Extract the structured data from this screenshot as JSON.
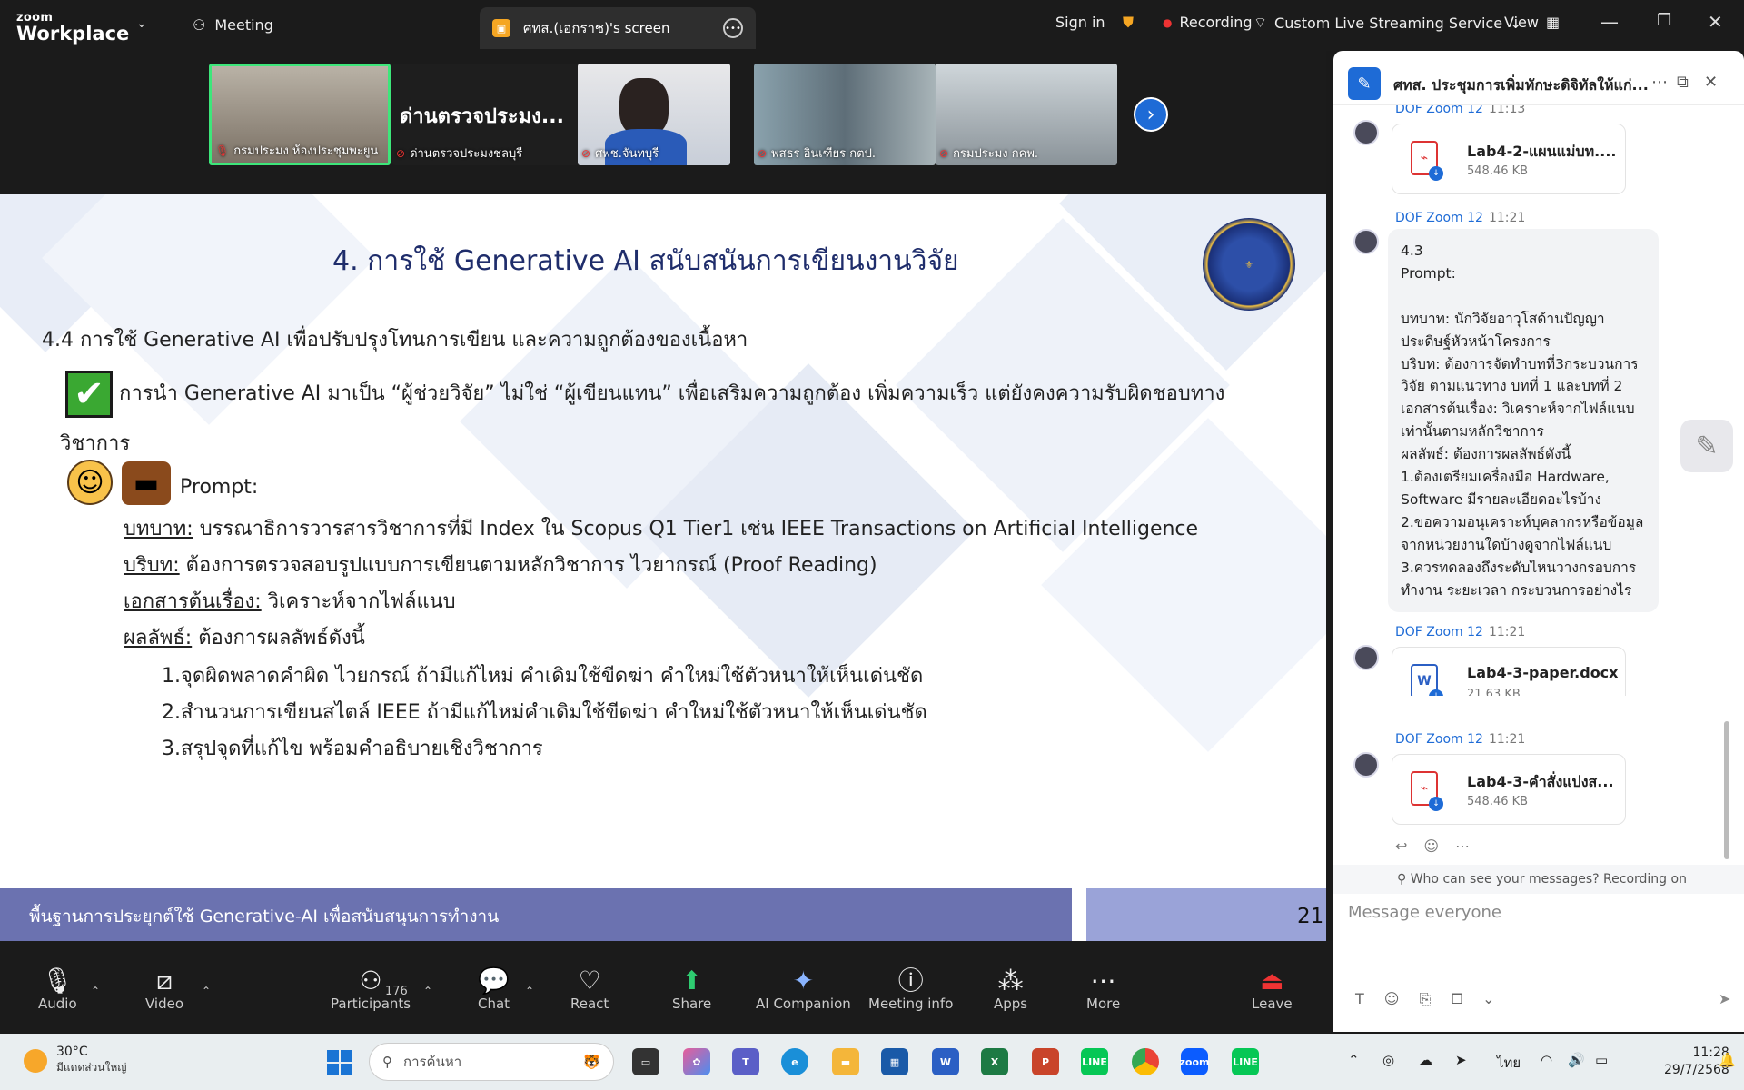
{
  "topbar": {
    "logo_line1": "zoom",
    "logo_line2": "Workplace",
    "meeting_label": "Meeting",
    "screen_tab": "ศทส.(เอกราช)'s screen",
    "sign_in": "Sign in",
    "recording": "Recording",
    "streaming": "Custom Live Streaming Service",
    "view": "View"
  },
  "participants_strip": [
    {
      "label": "กรมประมง ห้องประชุมพะยูน",
      "active": true
    },
    {
      "label": "ด่านตรวจประมงชลบุรี",
      "heading": "ด่านตรวจประมง...",
      "active": false
    },
    {
      "label": "ศพช.จันทบุรี",
      "active": false
    },
    {
      "label": "พสธร อินเฑียร กตป.",
      "active": false
    },
    {
      "label": "กรมประมง กคพ.",
      "active": false
    }
  ],
  "slide": {
    "title": "4. การใช้ Generative AI สนับสนันการเขียนงานวิจัย",
    "section": "4.4 การใช้ Generative AI เพื่อปรับปรุงโทนการเขียน และความถูกต้องของเนื้อหา",
    "point_line1": "การนำ Generative AI มาเป็น “ผู้ช่วยวิจัย” ไม่ใช่ “ผู้เขียนแทน” เพื่อเสริมความถูกต้อง เพิ่มความเร็ว แต่ยังคงความรับผิดชอบทาง",
    "point_line2": "วิชาการ",
    "prompt_label": "Prompt:",
    "role_label": "บทบาท:",
    "role_text": " บรรณาธิการวารสารวิชาการที่มี Index ใน Scopus Q1 Tier1 เช่น IEEE Transactions on Artificial Intelligence",
    "context_label": "บริบท:",
    "context_text": " ต้องการตรวจสอบรูปแบบการเขียนตามหลักวิชาการ ไวยากรณ์ (Proof Reading)",
    "doc_label": "เอกสารต้นเรื่อง:",
    "doc_text": "  วิเคราะห์จากไฟล์แนบ",
    "result_label": "ผลลัพธ์:",
    "result_text": "  ต้องการผลลัพธ์ดังนี้",
    "items": [
      "1.จุดผิดพลาดคำผิด ไวยกรณ์ ถ้ามีแก้ไหม่ คำเดิมใช้ขีดฆ่า คำใหม่ใช้ตัวหนาให้เห็นเด่นชัด",
      "2.สำนวนการเขียนสไตล์ IEEE  ถ้ามีแก้ไหม่คำเดิมใช้ขีดฆ่า คำใหม่ใช้ตัวหนาให้เห็นเด่นชัด",
      "3.สรุปจุดที่แก้ไข พร้อมคำอธิบายเชิงวิชาการ"
    ],
    "footer": "พื้นฐานการประยุกต์ใช้ Generative-AI เพื่อสนับสนุนการทำงาน",
    "page": "21"
  },
  "toolbar": {
    "audio": "Audio",
    "video": "Video",
    "participants": "Participants",
    "participants_count": "176",
    "chat": "Chat",
    "react": "React",
    "share": "Share",
    "ai_companion": "AI Companion",
    "meeting_info": "Meeting info",
    "apps": "Apps",
    "more": "More",
    "leave": "Leave"
  },
  "chat": {
    "title": "ศทส. ประชุมการเพิ่มทักษะดิจิทัลให้แก่...",
    "messages": [
      {
        "sender": "DOF Zoom 12",
        "time": "11:13",
        "file": "Lab4-2-แผนแม่บท....",
        "size": "548.46 KB",
        "type": "pdf"
      },
      {
        "sender": "DOF Zoom 12",
        "time": "11:21"
      },
      {
        "sender": "DOF Zoom 12",
        "time": "11:21",
        "file": "Lab4-3-paper.docx",
        "size": "21.63 KB",
        "type": "docx"
      },
      {
        "sender": "DOF Zoom 12",
        "time": "11:21",
        "file": "Lab4-3-คำสั่งแบ่งส...",
        "size": "548.46 KB",
        "type": "pdf"
      }
    ],
    "text_message": "4.3\nPrompt:\n\nบทบาท: นักวิจัยอาวุโสด้านปัญญา\nประดิษฐ์หัวหน้าโครงการ\nบริบท: ต้องการจัดทำบทที่3กระบวนการ\nวิจัย ตามแนวทาง บทที่ 1 และบทที่ 2\nเอกสารต้นเรื่อง:  วิเคราะห์จากไฟล์แนบ\nเท่านั้นตามหลักวิชาการ\nผลลัพธ์:  ต้องการผลลัพธ์ดังนี้\n1.ต้องเตรียมเครื่องมือ Hardware,\nSoftware มีรายละเอียดอะไรบ้าง\n2.ขอความอนุเคราะห์บุคลากรหรือข้อมูล\nจากหน่วยงานใดบ้างดูจากไฟล์แนบ\n3.ควรทดลองถึงระดับไหนวางกรอบการ\nทำงาน ระยะเวลา กระบวนการอย่างไร",
    "privacy": "Who can see your messages? Recording on",
    "input_placeholder": "Message everyone"
  },
  "taskbar": {
    "temp": "30°C",
    "weather": "มีแดดส่วนใหญ่",
    "search": "การค้นหา",
    "lang": "ไทย",
    "time": "11:28",
    "date": "29/7/2568"
  }
}
